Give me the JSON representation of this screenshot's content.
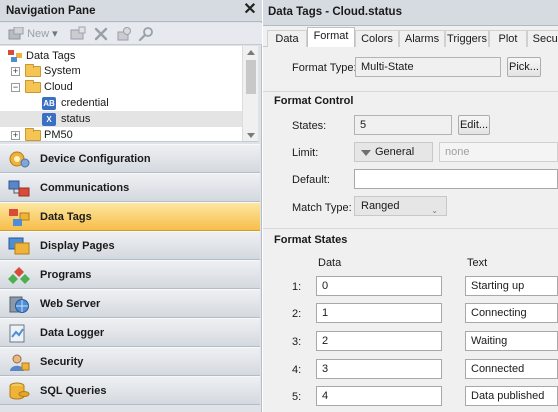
{
  "nav": {
    "title": "Navigation Pane",
    "close_glyph": "✕",
    "toolbar": {
      "new_label": "New",
      "new_caret": "▾"
    },
    "tree": [
      {
        "label": "Data Tags",
        "icon": "data-tags-icon",
        "expander": ""
      },
      {
        "label": "System",
        "icon": "folder-icon",
        "expander": "+"
      },
      {
        "label": "Cloud",
        "icon": "folder-icon",
        "expander": "−"
      },
      {
        "label": "credential",
        "icon": "string-tag-icon",
        "badge": "AB",
        "badge_color": "#3a6fc4"
      },
      {
        "label": "status",
        "icon": "multistate-tag-icon",
        "badge": "X",
        "badge_color": "#3a6fc4",
        "selected": true
      },
      {
        "label": "PM50",
        "icon": "folder-icon",
        "expander": "+"
      }
    ],
    "sections": [
      {
        "label": "Device Configuration",
        "icon": "device-configuration-icon"
      },
      {
        "label": "Communications",
        "icon": "communications-icon"
      },
      {
        "label": "Data Tags",
        "icon": "data-tags-icon",
        "active": true
      },
      {
        "label": "Display Pages",
        "icon": "display-pages-icon"
      },
      {
        "label": "Programs",
        "icon": "programs-icon"
      },
      {
        "label": "Web Server",
        "icon": "web-server-icon"
      },
      {
        "label": "Data Logger",
        "icon": "data-logger-icon"
      },
      {
        "label": "Security",
        "icon": "security-icon"
      },
      {
        "label": "SQL Queries",
        "icon": "sql-queries-icon"
      }
    ]
  },
  "editor": {
    "title": "Data Tags - Cloud.status",
    "tabs": [
      "Data",
      "Format",
      "Colors",
      "Alarms",
      "Triggers",
      "Plot",
      "Secur"
    ],
    "active_tab": "Format",
    "format_type_label": "Format Type:",
    "format_type_value": "Multi-State",
    "pick_button": "Pick...",
    "format_control_heading": "Format Control",
    "states_label": "States:",
    "states_value": "5",
    "edit_button": "Edit...",
    "limit_label": "Limit:",
    "limit_value": "General",
    "limit_placeholder": "none",
    "default_label": "Default:",
    "default_value": "",
    "match_type_label": "Match Type:",
    "match_type_value": "Ranged",
    "format_states_heading": "Format States",
    "data_col": "Data",
    "text_col": "Text",
    "states": [
      {
        "index": "1:",
        "data": "0",
        "text": "Starting up"
      },
      {
        "index": "2:",
        "data": "1",
        "text": "Connecting"
      },
      {
        "index": "3:",
        "data": "2",
        "text": "Waiting"
      },
      {
        "index": "4:",
        "data": "3",
        "text": "Connected"
      },
      {
        "index": "5:",
        "data": "4",
        "text": "Data published"
      }
    ]
  }
}
